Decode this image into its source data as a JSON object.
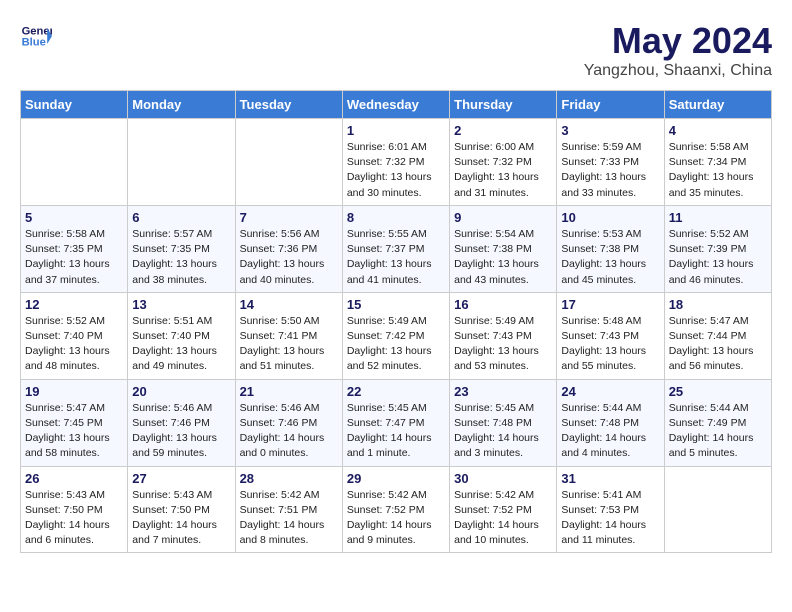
{
  "logo": {
    "line1": "General",
    "line2": "Blue"
  },
  "title": "May 2024",
  "subtitle": "Yangzhou, Shaanxi, China",
  "weekdays": [
    "Sunday",
    "Monday",
    "Tuesday",
    "Wednesday",
    "Thursday",
    "Friday",
    "Saturday"
  ],
  "weeks": [
    [
      {
        "day": "",
        "info": ""
      },
      {
        "day": "",
        "info": ""
      },
      {
        "day": "",
        "info": ""
      },
      {
        "day": "1",
        "info": "Sunrise: 6:01 AM\nSunset: 7:32 PM\nDaylight: 13 hours\nand 30 minutes."
      },
      {
        "day": "2",
        "info": "Sunrise: 6:00 AM\nSunset: 7:32 PM\nDaylight: 13 hours\nand 31 minutes."
      },
      {
        "day": "3",
        "info": "Sunrise: 5:59 AM\nSunset: 7:33 PM\nDaylight: 13 hours\nand 33 minutes."
      },
      {
        "day": "4",
        "info": "Sunrise: 5:58 AM\nSunset: 7:34 PM\nDaylight: 13 hours\nand 35 minutes."
      }
    ],
    [
      {
        "day": "5",
        "info": "Sunrise: 5:58 AM\nSunset: 7:35 PM\nDaylight: 13 hours\nand 37 minutes."
      },
      {
        "day": "6",
        "info": "Sunrise: 5:57 AM\nSunset: 7:35 PM\nDaylight: 13 hours\nand 38 minutes."
      },
      {
        "day": "7",
        "info": "Sunrise: 5:56 AM\nSunset: 7:36 PM\nDaylight: 13 hours\nand 40 minutes."
      },
      {
        "day": "8",
        "info": "Sunrise: 5:55 AM\nSunset: 7:37 PM\nDaylight: 13 hours\nand 41 minutes."
      },
      {
        "day": "9",
        "info": "Sunrise: 5:54 AM\nSunset: 7:38 PM\nDaylight: 13 hours\nand 43 minutes."
      },
      {
        "day": "10",
        "info": "Sunrise: 5:53 AM\nSunset: 7:38 PM\nDaylight: 13 hours\nand 45 minutes."
      },
      {
        "day": "11",
        "info": "Sunrise: 5:52 AM\nSunset: 7:39 PM\nDaylight: 13 hours\nand 46 minutes."
      }
    ],
    [
      {
        "day": "12",
        "info": "Sunrise: 5:52 AM\nSunset: 7:40 PM\nDaylight: 13 hours\nand 48 minutes."
      },
      {
        "day": "13",
        "info": "Sunrise: 5:51 AM\nSunset: 7:40 PM\nDaylight: 13 hours\nand 49 minutes."
      },
      {
        "day": "14",
        "info": "Sunrise: 5:50 AM\nSunset: 7:41 PM\nDaylight: 13 hours\nand 51 minutes."
      },
      {
        "day": "15",
        "info": "Sunrise: 5:49 AM\nSunset: 7:42 PM\nDaylight: 13 hours\nand 52 minutes."
      },
      {
        "day": "16",
        "info": "Sunrise: 5:49 AM\nSunset: 7:43 PM\nDaylight: 13 hours\nand 53 minutes."
      },
      {
        "day": "17",
        "info": "Sunrise: 5:48 AM\nSunset: 7:43 PM\nDaylight: 13 hours\nand 55 minutes."
      },
      {
        "day": "18",
        "info": "Sunrise: 5:47 AM\nSunset: 7:44 PM\nDaylight: 13 hours\nand 56 minutes."
      }
    ],
    [
      {
        "day": "19",
        "info": "Sunrise: 5:47 AM\nSunset: 7:45 PM\nDaylight: 13 hours\nand 58 minutes."
      },
      {
        "day": "20",
        "info": "Sunrise: 5:46 AM\nSunset: 7:46 PM\nDaylight: 13 hours\nand 59 minutes."
      },
      {
        "day": "21",
        "info": "Sunrise: 5:46 AM\nSunset: 7:46 PM\nDaylight: 14 hours\nand 0 minutes."
      },
      {
        "day": "22",
        "info": "Sunrise: 5:45 AM\nSunset: 7:47 PM\nDaylight: 14 hours\nand 1 minute."
      },
      {
        "day": "23",
        "info": "Sunrise: 5:45 AM\nSunset: 7:48 PM\nDaylight: 14 hours\nand 3 minutes."
      },
      {
        "day": "24",
        "info": "Sunrise: 5:44 AM\nSunset: 7:48 PM\nDaylight: 14 hours\nand 4 minutes."
      },
      {
        "day": "25",
        "info": "Sunrise: 5:44 AM\nSunset: 7:49 PM\nDaylight: 14 hours\nand 5 minutes."
      }
    ],
    [
      {
        "day": "26",
        "info": "Sunrise: 5:43 AM\nSunset: 7:50 PM\nDaylight: 14 hours\nand 6 minutes."
      },
      {
        "day": "27",
        "info": "Sunrise: 5:43 AM\nSunset: 7:50 PM\nDaylight: 14 hours\nand 7 minutes."
      },
      {
        "day": "28",
        "info": "Sunrise: 5:42 AM\nSunset: 7:51 PM\nDaylight: 14 hours\nand 8 minutes."
      },
      {
        "day": "29",
        "info": "Sunrise: 5:42 AM\nSunset: 7:52 PM\nDaylight: 14 hours\nand 9 minutes."
      },
      {
        "day": "30",
        "info": "Sunrise: 5:42 AM\nSunset: 7:52 PM\nDaylight: 14 hours\nand 10 minutes."
      },
      {
        "day": "31",
        "info": "Sunrise: 5:41 AM\nSunset: 7:53 PM\nDaylight: 14 hours\nand 11 minutes."
      },
      {
        "day": "",
        "info": ""
      }
    ]
  ]
}
